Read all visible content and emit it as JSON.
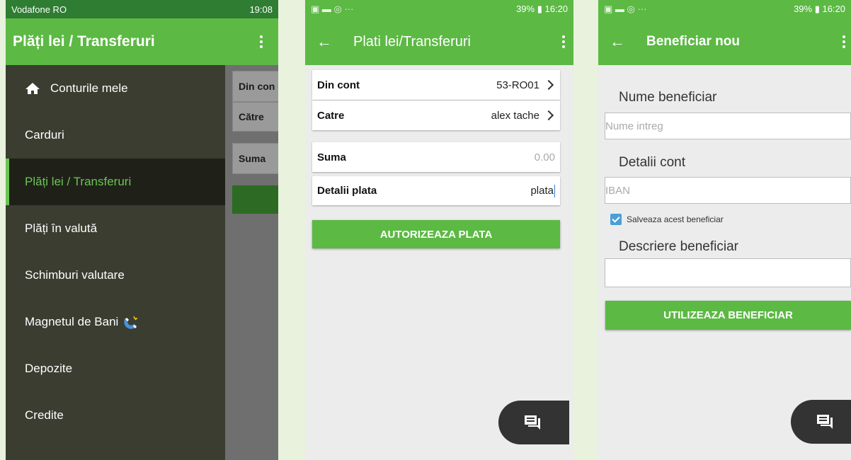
{
  "panel1": {
    "status": {
      "carrier": "Vodafone RO",
      "time": "19:08"
    },
    "title": "Plăți lei / Transferuri",
    "menu": [
      {
        "label": "Conturile mele"
      },
      {
        "label": "Carduri"
      },
      {
        "label": "Plăți lei / Transferuri"
      },
      {
        "label": "Plăți în valută"
      },
      {
        "label": "Schimburi valutare"
      },
      {
        "label": "Magnetul de Bani"
      },
      {
        "label": "Depozite"
      },
      {
        "label": "Credite"
      }
    ],
    "behind": {
      "din_cont": "Din con",
      "catre": "Către",
      "suma": "Suma"
    }
  },
  "panel2": {
    "status": {
      "right": "39% ▮ 16:20"
    },
    "title": "Plati lei/Transferuri",
    "fields": {
      "din_cont": {
        "label": "Din cont",
        "value": "53-RO01"
      },
      "catre": {
        "label": "Catre",
        "value": "alex tache"
      },
      "suma": {
        "label": "Suma",
        "placeholder": "0.00"
      },
      "detalii": {
        "label": "Detalii plata",
        "value": "plata"
      }
    },
    "button": "AUTORIZEAZA PLATA"
  },
  "panel3": {
    "status": {
      "right": "39% ▮ 16:20"
    },
    "title": "Beneficiar nou",
    "nume_label": "Nume beneficiar",
    "nume_placeholder": "Nume intreg",
    "detalii_label": "Detalii cont",
    "iban_placeholder": "IBAN",
    "checkbox_label": "Salveaza acest beneficiar",
    "descriere_label": "Descriere beneficiar",
    "button": "UTILIZEAZA BENEFICIAR"
  },
  "colors": {
    "green": "#5cb944",
    "drawer": "#3a3d30",
    "active": "#6cc353"
  }
}
